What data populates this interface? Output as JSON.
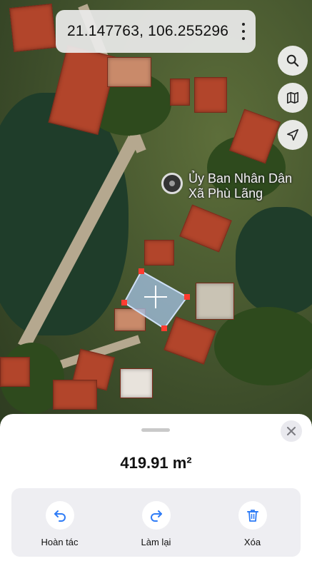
{
  "map": {
    "coordinates": "21.147763, 106.255296",
    "poi_label_line1": "Ủy Ban Nhân Dân",
    "poi_label_line2": "Xã Phù Lãng",
    "polygon_color": "#a9c8ee",
    "vertex_color": "#ff3b30"
  },
  "controls": {
    "more_icon": "more-vertical-icon",
    "search_icon": "search-icon",
    "map_icon": "map-icon",
    "locate_icon": "location-arrow-icon"
  },
  "sheet": {
    "area_value": "419.91 m²",
    "actions": [
      {
        "label": "Hoàn tác",
        "icon": "undo-icon"
      },
      {
        "label": "Làm lại",
        "icon": "redo-icon"
      },
      {
        "label": "Xóa",
        "icon": "trash-icon"
      }
    ],
    "accent_color": "#2f7cf6"
  }
}
